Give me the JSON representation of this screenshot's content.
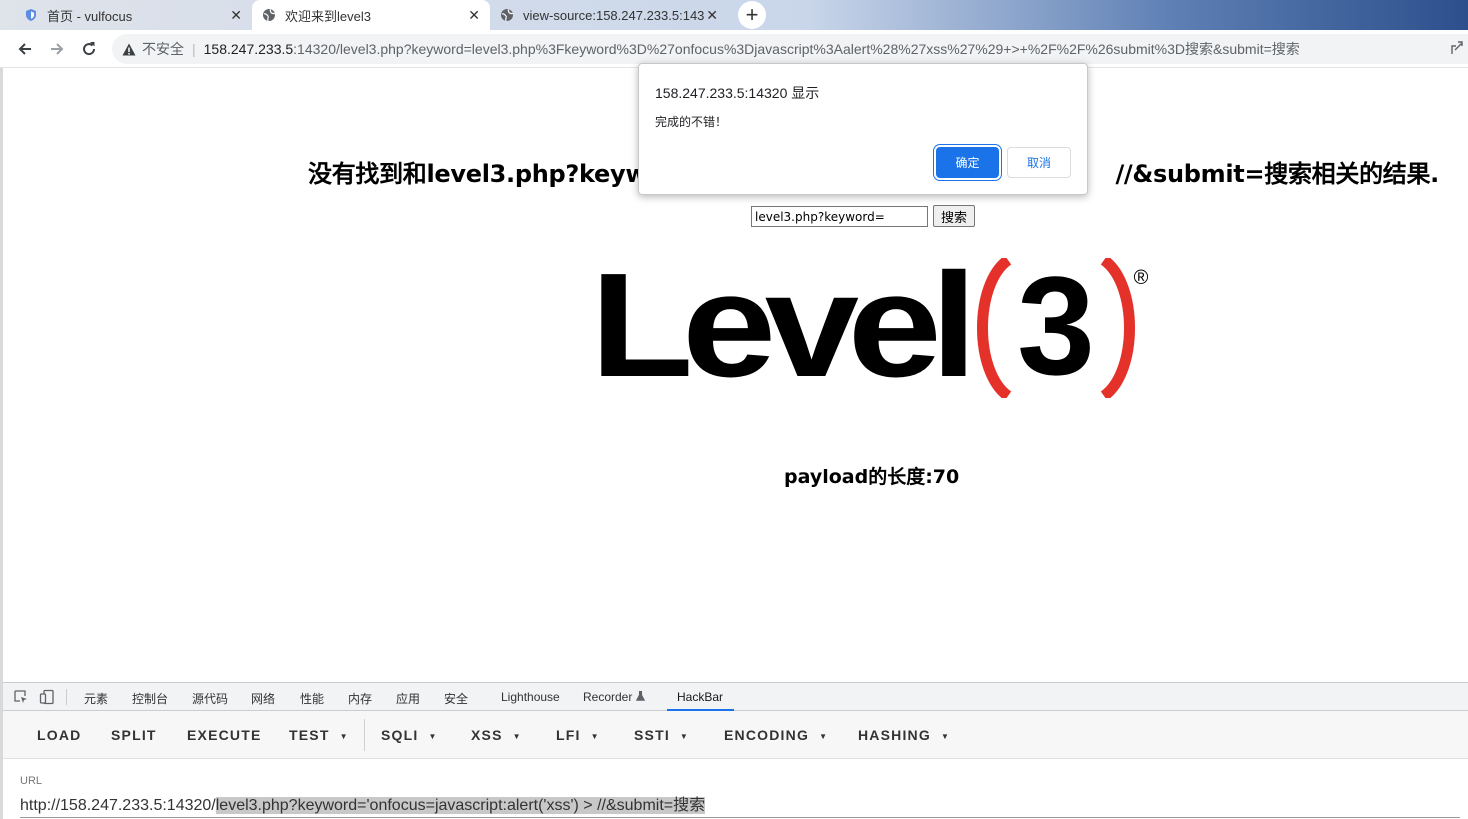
{
  "tabs": [
    {
      "title": "首页 - vulfocus",
      "icon": "shield-icon"
    },
    {
      "title": "欢迎来到level3",
      "icon": "globe-icon"
    },
    {
      "title": "view-source:158.247.233.5:143",
      "icon": "globe-icon"
    }
  ],
  "toolbar": {
    "security_label": "不安全",
    "url_host": "158.247.233.5",
    "url_rest": ":14320/level3.php?keyword=level3.php%3Fkeyword%3D%27onfocus%3Djavascript%3Aalert%28%27xss%27%29+>+%2F%2F%26submit%3D搜索&submit=搜索"
  },
  "page": {
    "heading_left": "没有找到和level3.php?keywo",
    "heading_right": "//&submit=搜索相关的结果.",
    "search_value": "level3.php?keyword=",
    "search_button": "搜索",
    "logo_text": "Level",
    "logo_number": "3",
    "logo_registered": "®",
    "payload_label": "payload的长度:70"
  },
  "dialog": {
    "title": "158.247.233.5:14320 显示",
    "message": "完成的不错！",
    "ok": "确定",
    "cancel": "取消"
  },
  "devtools": {
    "tabs": [
      "元素",
      "控制台",
      "源代码",
      "网络",
      "性能",
      "内存",
      "应用",
      "安全",
      "Lighthouse",
      "Recorder",
      "HackBar"
    ]
  },
  "hackbar": {
    "buttons": [
      "LOAD",
      "SPLIT",
      "EXECUTE",
      "TEST",
      "SQLI",
      "XSS",
      "LFI",
      "SSTI",
      "ENCODING",
      "HASHING"
    ],
    "url_label": "URL",
    "url_prefix": "http://158.247.233.5:14320/",
    "url_selected": "level3.php?keyword='onfocus=javascript:alert('xss') > //&submit=搜索"
  },
  "colors": {
    "accent": "#1a73e8",
    "logo_red": "#e4322b"
  }
}
